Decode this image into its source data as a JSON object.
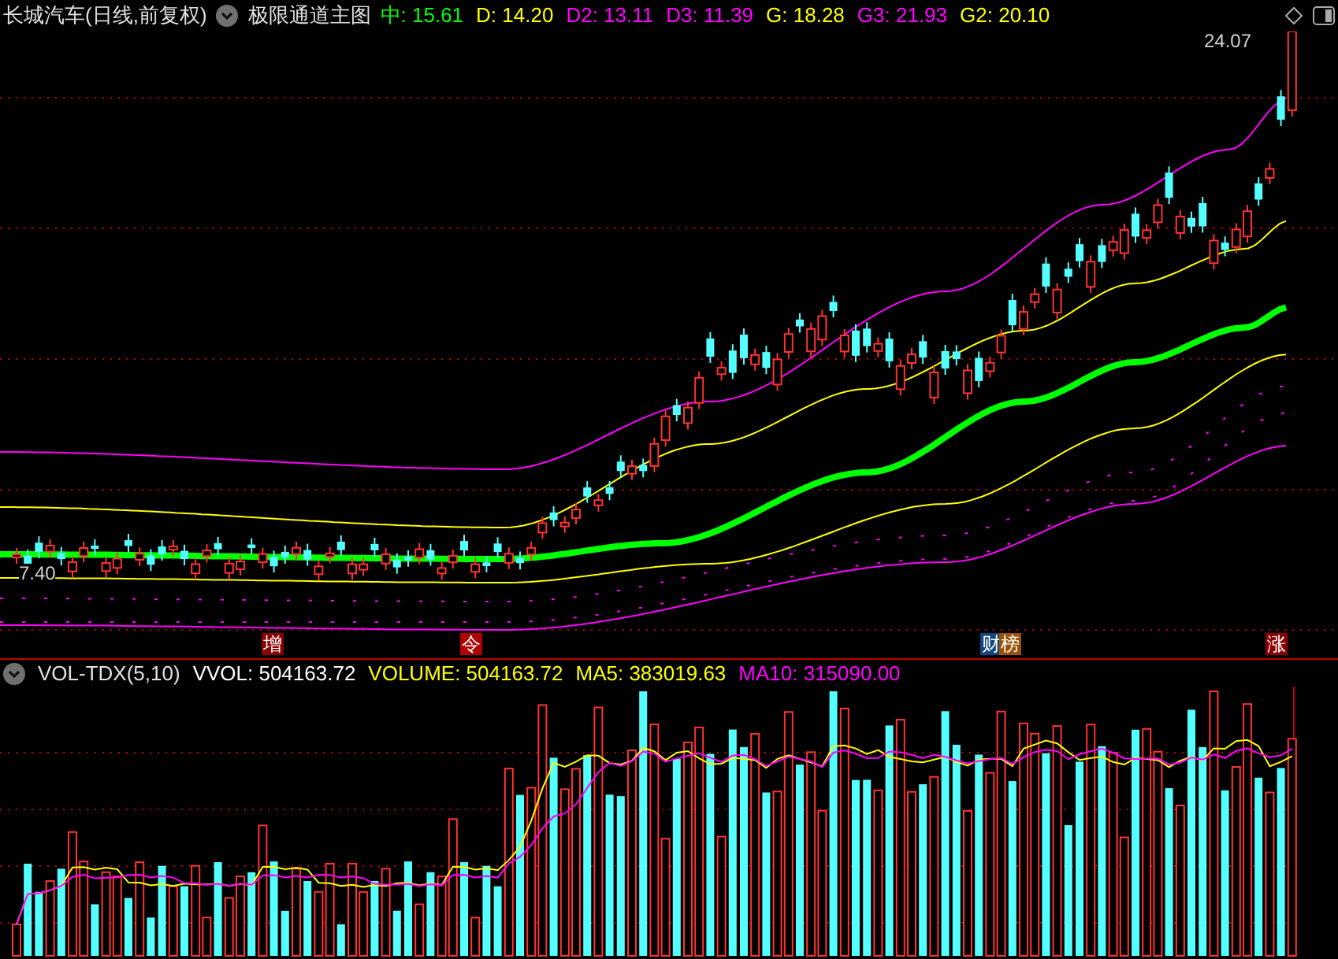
{
  "header": {
    "stock": "长城汽车(日线,前复权)",
    "indicator": "极限通道主图",
    "values": [
      {
        "text": "中: 15.61",
        "color": "#00ff00"
      },
      {
        "text": "D: 14.20",
        "color": "#ffff00"
      },
      {
        "text": "D2: 13.11",
        "color": "#ff00ff"
      },
      {
        "text": "D3: 11.39",
        "color": "#ff00ff"
      },
      {
        "text": "G: 18.28",
        "color": "#ffff00"
      },
      {
        "text": "G3: 21.93",
        "color": "#ff00ff"
      },
      {
        "text": "G2: 20.10",
        "color": "#ffff00"
      }
    ]
  },
  "price_labels": {
    "high": "24.07",
    "low": "7.40"
  },
  "signals": [
    {
      "text": "增",
      "color": "#8b0000"
    },
    {
      "text": "令",
      "color": "#b00000"
    },
    {
      "text": "财",
      "color": "#12467e"
    },
    {
      "text": "榜",
      "color": "#9a5208"
    },
    {
      "text": "涨",
      "color": "#8b0000"
    }
  ],
  "volume": {
    "indicator": "VOL-TDX(5,10)",
    "values": [
      {
        "text": "VVOL: 504163.72",
        "color": "#ffffff"
      },
      {
        "text": "VOLUME: 504163.72",
        "color": "#ffff00"
      },
      {
        "text": "MA5: 383019.63",
        "color": "#ffff00"
      },
      {
        "text": "MA10: 315090.00",
        "color": "#ff00ff"
      }
    ]
  }
}
